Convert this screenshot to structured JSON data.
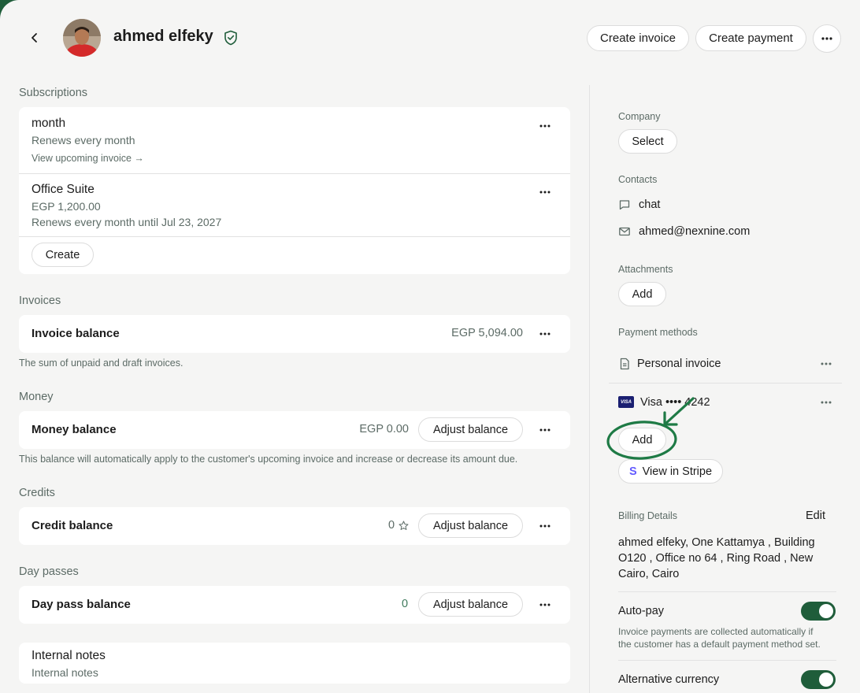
{
  "header": {
    "customer_name": "ahmed elfeky",
    "create_invoice": "Create invoice",
    "create_payment": "Create payment"
  },
  "subscriptions": {
    "label": "Subscriptions",
    "items": [
      {
        "name": "month",
        "line1": "Renews every month",
        "link": "View upcoming invoice →"
      },
      {
        "name": "Office Suite",
        "line1": "EGP 1,200.00",
        "line2": "Renews every month until Jul 23, 2027"
      }
    ],
    "create_label": "Create"
  },
  "invoices": {
    "label": "Invoices",
    "row_title": "Invoice balance",
    "amount": "EGP 5,094.00",
    "hint": "The sum of unpaid and draft invoices."
  },
  "money": {
    "label": "Money",
    "row_title": "Money balance",
    "amount": "EGP 0.00",
    "adjust": "Adjust balance",
    "hint": "This balance will automatically apply to the customer's upcoming invoice and increase or decrease its amount due."
  },
  "credits": {
    "label": "Credits",
    "row_title": "Credit balance",
    "amount": "0",
    "adjust": "Adjust balance"
  },
  "day_passes": {
    "label": "Day passes",
    "row_title": "Day pass balance",
    "amount": "0",
    "adjust": "Adjust balance"
  },
  "notes": {
    "title": "Internal notes",
    "placeholder": "Internal notes"
  },
  "sidebar": {
    "company_label": "Company",
    "company_select": "Select",
    "contacts_label": "Contacts",
    "contact_chat": "chat",
    "contact_email": "ahmed@nexnine.com",
    "attachments_label": "Attachments",
    "attachments_add": "Add",
    "payment_methods_label": "Payment methods",
    "pm_personal": "Personal invoice",
    "pm_visa_brand": "VISA",
    "pm_visa": "Visa •••• 4242",
    "pm_add": "Add",
    "view_stripe": "View in Stripe",
    "billing_label": "Billing Details",
    "billing_edit": "Edit",
    "billing_line1": "ahmed elfeky, One Kattamya , Building",
    "billing_line2": "O120 , Office no 64 , Ring Road , New",
    "billing_line3": "Cairo, Cairo",
    "autopay_label": "Auto-pay",
    "autopay_hint1": "Invoice payments are collected automatically if",
    "autopay_hint2": "the customer has a default payment method set.",
    "alt_currency_label": "Alternative currency"
  },
  "colors": {
    "accent": "#1f5d3a",
    "annotation": "#1e7a45",
    "muted": "#5c6b66"
  }
}
